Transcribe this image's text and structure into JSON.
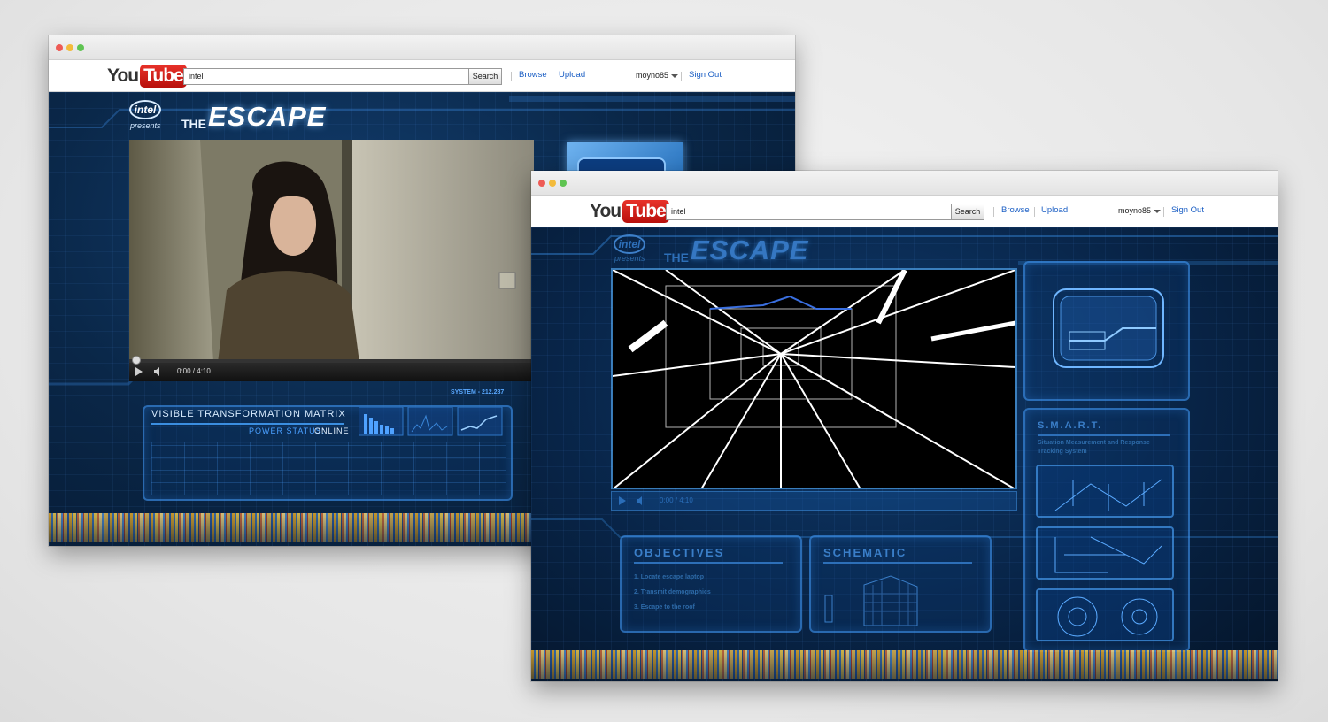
{
  "youtube": {
    "logo_you": "You",
    "logo_tube": "Tube",
    "search_value": "intel",
    "search_button": "Search",
    "browse": "Browse",
    "upload": "Upload",
    "username": "moyno85",
    "sign_out": "Sign Out"
  },
  "brand": {
    "intel_badge": "intel",
    "presents": "presents",
    "the": "THE",
    "escape": "ESCAPE"
  },
  "player": {
    "time_display": "0:00 / 4:10"
  },
  "panel_back": {
    "title": "VISIBLE TRANSFORMATION MATRIX",
    "power_label": "POWER STATUS:",
    "power_value": "ONLINE",
    "system_label": "SYSTEM - 212.287"
  },
  "panel_front": {
    "objectives_title": "OBJECTIVES",
    "objective_1": "1. Locate escape laptop",
    "objective_2": "2. Transmit demographics",
    "objective_3": "3. Escape to the roof",
    "schematic_title": "SCHEMATIC",
    "smart_title": "S.M.A.R.T.",
    "smart_sub_1": "Situation Measurement and Response",
    "smart_sub_2": "Tracking System"
  },
  "colors": {
    "youtube_red": "#cc181e",
    "link_blue": "#1a5ec4",
    "hud_blue": "#3a7ec8",
    "dark_navy": "#061a33"
  }
}
